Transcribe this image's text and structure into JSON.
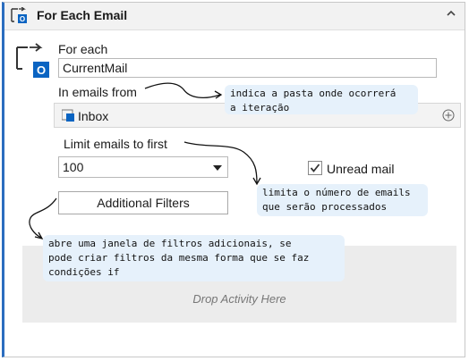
{
  "header": {
    "title": "For Each Email"
  },
  "for_each": {
    "label": "For each",
    "value": "CurrentMail"
  },
  "emails_from": {
    "label": "In emails from",
    "folder": "Inbox"
  },
  "limit": {
    "label": "Limit emails to first",
    "selected": "100"
  },
  "unread": {
    "label": "Unread mail",
    "checked": true
  },
  "filters_button": {
    "label": "Additional Filters"
  },
  "drop_area": {
    "text": "Drop Activity Here"
  },
  "annotations": {
    "folder_note": [
      "indica a pasta onde ocorrerá",
      "a iteração"
    ],
    "limit_note": [
      "limita o número de emails",
      "que serão processados"
    ],
    "filters_note": [
      "abre uma janela de filtros adicionais, se",
      "pode criar filtros da mesma forma que se faz",
      "condições if"
    ]
  },
  "colors": {
    "accent": "#2b6dbf",
    "outlook_blue": "#0a64c2",
    "note_bg": "#e6f1fb"
  },
  "icons": [
    "for-each-email-icon",
    "collapse-chevron-icon",
    "outlook-icon",
    "folder-icon",
    "add-circle-icon",
    "dropdown-arrow-icon",
    "checkbox-check-icon"
  ]
}
